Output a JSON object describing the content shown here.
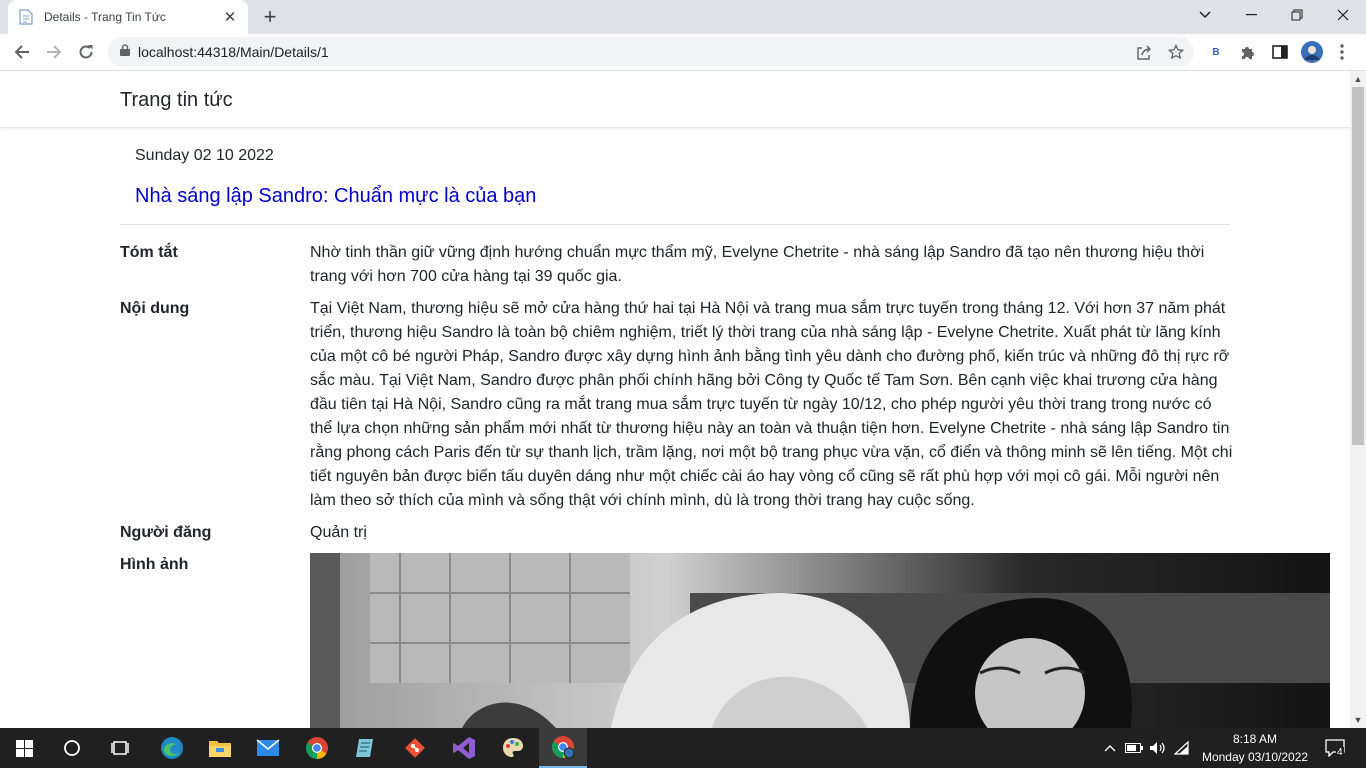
{
  "browser": {
    "tab_title": "Details - Trang Tin Tức",
    "url": "localhost:44318/Main/Details/1",
    "extension_badge": "B"
  },
  "site": {
    "brand": "Trang tin tức"
  },
  "article": {
    "date": "Sunday 02 10 2022",
    "title": "Nhà sáng lập Sandro: Chuẩn mực là của bạn",
    "fields": {
      "summary_label": "Tóm tắt",
      "summary": "Nhờ tinh thần giữ vững định hướng chuẩn mực thẩm mỹ, Evelyne Chetrite - nhà sáng lập Sandro đã tạo nên thương hiệu thời trang với hơn 700 cửa hàng tại 39 quốc gia.",
      "content_label": "Nội dung",
      "content": "Tại Việt Nam, thương hiệu sẽ mở cửa hàng thứ hai tại Hà Nội và trang mua sắm trực tuyến trong tháng 12. Với hơn 37 năm phát triển, thương hiệu Sandro là toàn bộ chiêm nghiệm, triết lý thời trang của nhà sáng lập - Evelyne Chetrite. Xuất phát từ lăng kính của một cô bé người Pháp, Sandro được xây dựng hình ảnh bằng tình yêu dành cho đường phố, kiến trúc và những đô thị rực rỡ sắc màu. Tại Việt Nam, Sandro được phân phối chính hãng bởi Công ty Quốc tế Tam Sơn. Bên cạnh việc khai trương cửa hàng đầu tiên tại Hà Nội, Sandro cũng ra mắt trang mua sắm trực tuyến từ ngày 10/12, cho phép người yêu thời trang trong nước có thể lựa chọn những sản phẩm mới nhất từ thương hiệu này an toàn và thuận tiện hơn. Evelyne Chetrite - nhà sáng lập Sandro tin rằng phong cách Paris đến từ sự thanh lịch, trầm lặng, nơi một bộ trang phục vừa vặn, cổ điển và thông minh sẽ lên tiếng. Một chi tiết nguyên bản được biến tấu duyên dáng như một chiếc cài áo hay vòng cổ cũng sẽ rất phù hợp với mọi cô gái. Mỗi người nên làm theo sở thích của mình và sống thật với chính mình, dù là trong thời trang hay cuộc sống.",
      "author_label": "Người đăng",
      "author": "Quản trị",
      "image_label": "Hình ảnh"
    }
  },
  "taskbar": {
    "time": "8:18 AM",
    "date": "Monday 03/10/2022",
    "notification_count": "4"
  }
}
